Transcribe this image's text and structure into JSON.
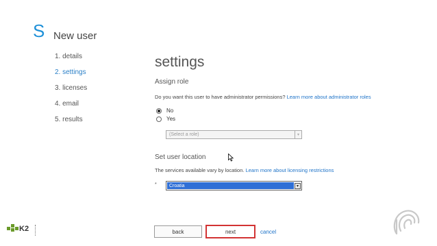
{
  "header": {
    "logo_glyph": "S",
    "title": "New user"
  },
  "steps": [
    {
      "label": "1.  details"
    },
    {
      "label": "2.  settings",
      "active": true
    },
    {
      "label": "3.  licenses"
    },
    {
      "label": "4.  email"
    },
    {
      "label": "5.  results"
    }
  ],
  "main": {
    "section_title": "settings",
    "assign_role": {
      "heading": "Assign role",
      "question": "Do you want this user to have administrator permissions? ",
      "learn_more": "Learn more about administrator roles",
      "options": [
        {
          "label": "No",
          "checked": true
        },
        {
          "label": "Yes",
          "checked": false
        }
      ],
      "role_select": {
        "value": "(Select a role)",
        "arrow": "▾"
      }
    },
    "location": {
      "heading": "Set user location",
      "description": "The services available vary by location. ",
      "learn_more": "Learn more about licensing restrictions",
      "required_mark": "*",
      "select": {
        "value": "Croatia",
        "arrow": "▾"
      }
    }
  },
  "buttons": {
    "back": "back",
    "next": "next",
    "cancel": "cancel"
  },
  "footer": {
    "brand": "K2"
  },
  "colors": {
    "accent": "#1e73c8",
    "highlight": "#d23232",
    "selection": "#2f6fd6",
    "k2_green": "#6a9a2a"
  }
}
